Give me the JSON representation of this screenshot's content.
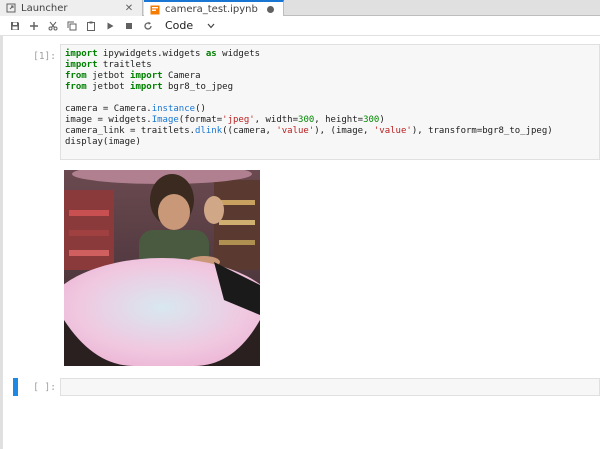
{
  "tabs": [
    {
      "label": "Launcher",
      "icon": "launcher-icon"
    },
    {
      "label": "camera_test.ipynb",
      "icon": "notebook-icon"
    }
  ],
  "toolbar": {
    "buttons": [
      "save-icon",
      "add-cell-icon",
      "cut-icon",
      "copy-icon",
      "paste-icon",
      "run-icon",
      "stop-icon",
      "restart-icon"
    ],
    "cell_type": "Code"
  },
  "cells": {
    "first": {
      "prompt": "[1]:",
      "code": {
        "l1": [
          "import",
          " ipywidgets.widgets ",
          "as",
          " widgets"
        ],
        "l2": [
          "import",
          " traitlets"
        ],
        "l3": [
          "from",
          " jetbot ",
          "import",
          " Camera"
        ],
        "l4": [
          "from",
          " jetbot ",
          "import",
          " bgr8_to_jpeg"
        ],
        "l6": [
          "camera = Camera.",
          "instance",
          "()"
        ],
        "l7": [
          "image = widgets.",
          "Image",
          "(format=",
          "'jpeg'",
          ", width=",
          "300",
          ", height=",
          "300",
          ")"
        ],
        "l8": [
          "camera_link = traitlets.",
          "dlink",
          "((camera, ",
          "'value'",
          "), (image, ",
          "'value'",
          "), transform=bgr8_to_jpeg)"
        ],
        "l9": [
          "display(image)"
        ]
      }
    },
    "second": {
      "prompt": "[ ]:"
    }
  },
  "colors": {
    "accent": "#1e88e5",
    "keyword": "#008000",
    "string": "#ba2121"
  }
}
